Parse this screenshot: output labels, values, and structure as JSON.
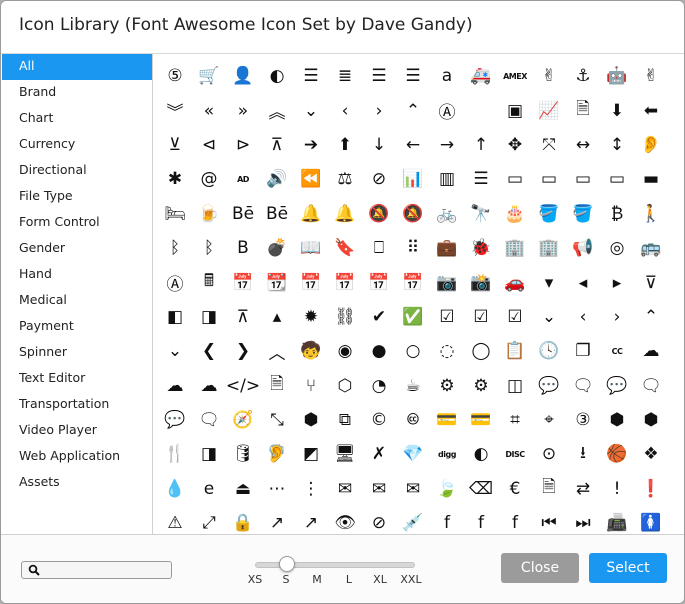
{
  "dialog": {
    "title": "Icon Library (Font Awesome Icon Set by Dave Gandy)"
  },
  "categories": [
    {
      "label": "All",
      "selected": true
    },
    {
      "label": "Brand"
    },
    {
      "label": "Chart"
    },
    {
      "label": "Currency"
    },
    {
      "label": "Directional"
    },
    {
      "label": "File Type"
    },
    {
      "label": "Form Control"
    },
    {
      "label": "Gender"
    },
    {
      "label": "Hand"
    },
    {
      "label": "Medical"
    },
    {
      "label": "Payment"
    },
    {
      "label": "Spinner"
    },
    {
      "label": "Text Editor"
    },
    {
      "label": "Transportation"
    },
    {
      "label": "Video Player"
    },
    {
      "label": "Web Application"
    },
    {
      "label": "Assets"
    }
  ],
  "icons": [
    {
      "name": "html5-icon",
      "glyph": "⑤"
    },
    {
      "name": "cart-plus-icon",
      "glyph": "🛒"
    },
    {
      "name": "user-plus-icon",
      "glyph": "👤"
    },
    {
      "name": "adjust-icon",
      "glyph": "◐"
    },
    {
      "name": "align-center-icon",
      "glyph": "☰"
    },
    {
      "name": "align-justify-icon",
      "glyph": "≣"
    },
    {
      "name": "align-left-icon",
      "glyph": "☰"
    },
    {
      "name": "align-right-icon",
      "glyph": "☰"
    },
    {
      "name": "amazon-icon",
      "glyph": "a"
    },
    {
      "name": "ambulance-icon",
      "glyph": "🚑"
    },
    {
      "name": "american-express-icon",
      "glyph": "AMEX",
      "small": true
    },
    {
      "name": "angellist-icon",
      "glyph": "✌"
    },
    {
      "name": "anchor-icon",
      "glyph": "⚓"
    },
    {
      "name": "android-icon",
      "glyph": "🤖"
    },
    {
      "name": "peace-hand-icon",
      "glyph": "✌"
    },
    {
      "name": "angle-double-down-icon",
      "glyph": "︾"
    },
    {
      "name": "angle-double-left-icon",
      "glyph": "«"
    },
    {
      "name": "angle-double-right-icon",
      "glyph": "»"
    },
    {
      "name": "angle-double-up-icon",
      "glyph": "︽"
    },
    {
      "name": "angle-down-icon",
      "glyph": "⌄"
    },
    {
      "name": "angle-left-icon",
      "glyph": "‹"
    },
    {
      "name": "angle-right-icon",
      "glyph": "›"
    },
    {
      "name": "angle-up-icon",
      "glyph": "⌃"
    },
    {
      "name": "app-store-icon",
      "glyph": "Ⓐ"
    },
    {
      "name": "apple-icon",
      "glyph": ""
    },
    {
      "name": "archive-icon",
      "glyph": "▣"
    },
    {
      "name": "area-chart-icon",
      "glyph": "📈"
    },
    {
      "name": "file-audio-icon",
      "glyph": "🗎"
    },
    {
      "name": "arrow-circle-down-icon",
      "glyph": "⬇"
    },
    {
      "name": "arrow-circle-left-icon",
      "glyph": "⬅"
    },
    {
      "name": "arrow-circle-o-down-icon",
      "glyph": "⊻"
    },
    {
      "name": "arrow-circle-o-left-icon",
      "glyph": "⊲"
    },
    {
      "name": "arrow-circle-o-right-icon",
      "glyph": "⊳"
    },
    {
      "name": "arrow-circle-o-up-icon",
      "glyph": "⊼"
    },
    {
      "name": "arrow-circle-right-icon",
      "glyph": "➔"
    },
    {
      "name": "arrow-circle-up-icon",
      "glyph": "⬆"
    },
    {
      "name": "arrow-down-icon",
      "glyph": "↓"
    },
    {
      "name": "arrow-left-icon",
      "glyph": "←"
    },
    {
      "name": "arrow-right-icon",
      "glyph": "→"
    },
    {
      "name": "arrow-up-icon",
      "glyph": "↑"
    },
    {
      "name": "arrows-icon",
      "glyph": "✥"
    },
    {
      "name": "arrows-alt-icon",
      "glyph": "⤧"
    },
    {
      "name": "arrows-h-icon",
      "glyph": "↔"
    },
    {
      "name": "arrows-v-icon",
      "glyph": "↕"
    },
    {
      "name": "assistive-listening-icon",
      "glyph": "👂"
    },
    {
      "name": "asterisk-icon",
      "glyph": "✱"
    },
    {
      "name": "at-icon",
      "glyph": "@"
    },
    {
      "name": "audio-description-icon",
      "glyph": "AD",
      "small": true
    },
    {
      "name": "file-audio-o-icon",
      "glyph": "🔊"
    },
    {
      "name": "backward-icon",
      "glyph": "⏪"
    },
    {
      "name": "balance-scale-icon",
      "glyph": "⚖"
    },
    {
      "name": "ban-icon",
      "glyph": "⊘"
    },
    {
      "name": "bar-chart-icon",
      "glyph": "📊"
    },
    {
      "name": "barcode-icon",
      "glyph": "▥"
    },
    {
      "name": "bars-icon",
      "glyph": "☰"
    },
    {
      "name": "battery-empty-icon",
      "glyph": "▭"
    },
    {
      "name": "battery-quarter-icon",
      "glyph": "▭"
    },
    {
      "name": "battery-half-icon",
      "glyph": "▭"
    },
    {
      "name": "battery-three-quarters-icon",
      "glyph": "▭"
    },
    {
      "name": "battery-full-icon",
      "glyph": "▬"
    },
    {
      "name": "bed-icon",
      "glyph": "🛏"
    },
    {
      "name": "beer-icon",
      "glyph": "🍺"
    },
    {
      "name": "behance-icon",
      "glyph": "Bē"
    },
    {
      "name": "behance-square-icon",
      "glyph": "Bē"
    },
    {
      "name": "bell-icon",
      "glyph": "🔔"
    },
    {
      "name": "bell-o-icon",
      "glyph": "🔔"
    },
    {
      "name": "bell-slash-icon",
      "glyph": "🔕"
    },
    {
      "name": "bell-slash-o-icon",
      "glyph": "🔕"
    },
    {
      "name": "bicycle-icon",
      "glyph": "🚲"
    },
    {
      "name": "binoculars-icon",
      "glyph": "🔭"
    },
    {
      "name": "birthday-cake-icon",
      "glyph": "🎂"
    },
    {
      "name": "bitbucket-icon",
      "glyph": "🪣"
    },
    {
      "name": "bitbucket-square-icon",
      "glyph": "🪣"
    },
    {
      "name": "bitcoin-icon",
      "glyph": "₿"
    },
    {
      "name": "blind-icon",
      "glyph": "🚶"
    },
    {
      "name": "bluetooth-icon",
      "glyph": "ᛒ"
    },
    {
      "name": "bluetooth-b-icon",
      "glyph": "ᛒ"
    },
    {
      "name": "bold-icon",
      "glyph": "B"
    },
    {
      "name": "bomb-icon",
      "glyph": "💣"
    },
    {
      "name": "book-icon",
      "glyph": "📖"
    },
    {
      "name": "bookmark-icon",
      "glyph": "🔖"
    },
    {
      "name": "bookmark-o-icon",
      "glyph": "⎕"
    },
    {
      "name": "braille-icon",
      "glyph": "⠿"
    },
    {
      "name": "briefcase-icon",
      "glyph": "💼"
    },
    {
      "name": "bug-icon",
      "glyph": "🐞"
    },
    {
      "name": "building-icon",
      "glyph": "🏢"
    },
    {
      "name": "building-o-icon",
      "glyph": "🏢"
    },
    {
      "name": "bullhorn-icon",
      "glyph": "📢"
    },
    {
      "name": "bullseye-icon",
      "glyph": "◎"
    },
    {
      "name": "bus-icon",
      "glyph": "🚌"
    },
    {
      "name": "buysellads-icon",
      "glyph": "Ⓐ"
    },
    {
      "name": "calculator-icon",
      "glyph": "🖩"
    },
    {
      "name": "calendar-icon",
      "glyph": "📅"
    },
    {
      "name": "calendar-o-icon",
      "glyph": "📆"
    },
    {
      "name": "calendar-minus-icon",
      "glyph": "📅"
    },
    {
      "name": "calendar-plus-icon",
      "glyph": "📅"
    },
    {
      "name": "calendar-times-icon",
      "glyph": "📅"
    },
    {
      "name": "calendar-check-icon",
      "glyph": "📅"
    },
    {
      "name": "camera-icon",
      "glyph": "📷"
    },
    {
      "name": "camera-retro-icon",
      "glyph": "📸"
    },
    {
      "name": "car-icon",
      "glyph": "🚗"
    },
    {
      "name": "caret-down-icon",
      "glyph": "▾"
    },
    {
      "name": "caret-left-icon",
      "glyph": "◂"
    },
    {
      "name": "caret-right-icon",
      "glyph": "▸"
    },
    {
      "name": "caret-square-down-icon",
      "glyph": "⊽"
    },
    {
      "name": "caret-square-left-icon",
      "glyph": "◧"
    },
    {
      "name": "caret-square-right-icon",
      "glyph": "◨"
    },
    {
      "name": "caret-square-up-icon",
      "glyph": "⊼"
    },
    {
      "name": "caret-up-icon",
      "glyph": "▴"
    },
    {
      "name": "certificate-icon",
      "glyph": "✹"
    },
    {
      "name": "chain-broken-icon",
      "glyph": "⛓"
    },
    {
      "name": "check-icon",
      "glyph": "✔"
    },
    {
      "name": "check-circle-icon",
      "glyph": "✅"
    },
    {
      "name": "check-circle-o-icon",
      "glyph": "☑"
    },
    {
      "name": "check-square-icon",
      "glyph": "☑"
    },
    {
      "name": "check-square-o-icon",
      "glyph": "☑"
    },
    {
      "name": "chevron-circle-down-icon",
      "glyph": "⌄"
    },
    {
      "name": "chevron-circle-left-icon",
      "glyph": "‹"
    },
    {
      "name": "chevron-circle-right-icon",
      "glyph": "›"
    },
    {
      "name": "chevron-circle-up-icon",
      "glyph": "⌃"
    },
    {
      "name": "chevron-down-icon",
      "glyph": "⌄"
    },
    {
      "name": "chevron-left-icon",
      "glyph": "❮"
    },
    {
      "name": "chevron-right-icon",
      "glyph": "❯"
    },
    {
      "name": "chevron-up-icon",
      "glyph": "︿"
    },
    {
      "name": "child-icon",
      "glyph": "🧒"
    },
    {
      "name": "chrome-icon",
      "glyph": "◉"
    },
    {
      "name": "circle-icon",
      "glyph": "●"
    },
    {
      "name": "circle-o-icon",
      "glyph": "○"
    },
    {
      "name": "circle-o-notch-icon",
      "glyph": "◌"
    },
    {
      "name": "circle-thin-icon",
      "glyph": "◯"
    },
    {
      "name": "clipboard-icon",
      "glyph": "📋"
    },
    {
      "name": "clock-icon",
      "glyph": "🕓"
    },
    {
      "name": "clone-icon",
      "glyph": "❐"
    },
    {
      "name": "closed-captioning-icon",
      "glyph": "CC",
      "small": true
    },
    {
      "name": "cloud-icon",
      "glyph": "☁"
    },
    {
      "name": "cloud-download-icon",
      "glyph": "☁"
    },
    {
      "name": "cloud-upload-icon",
      "glyph": "☁"
    },
    {
      "name": "code-icon",
      "glyph": "</>"
    },
    {
      "name": "file-code-icon",
      "glyph": "🗎"
    },
    {
      "name": "code-fork-icon",
      "glyph": "⑂"
    },
    {
      "name": "codepen-icon",
      "glyph": "⬡"
    },
    {
      "name": "codiepie-icon",
      "glyph": "◔"
    },
    {
      "name": "coffee-icon",
      "glyph": "☕"
    },
    {
      "name": "cog-icon",
      "glyph": "⚙"
    },
    {
      "name": "cogs-icon",
      "glyph": "⚙"
    },
    {
      "name": "columns-icon",
      "glyph": "◫"
    },
    {
      "name": "comment-icon",
      "glyph": "💬"
    },
    {
      "name": "comment-o-icon",
      "glyph": "🗨"
    },
    {
      "name": "commenting-icon",
      "glyph": "💬"
    },
    {
      "name": "commenting-o-icon",
      "glyph": "🗨"
    },
    {
      "name": "comments-icon",
      "glyph": "💬"
    },
    {
      "name": "comments-o-icon",
      "glyph": "🗨"
    },
    {
      "name": "compass-icon",
      "glyph": "🧭"
    },
    {
      "name": "compress-icon",
      "glyph": "⤡"
    },
    {
      "name": "connectdevelop-icon",
      "glyph": "⬢"
    },
    {
      "name": "contao-icon",
      "glyph": "⧉"
    },
    {
      "name": "copyright-icon",
      "glyph": "©"
    },
    {
      "name": "creative-commons-icon",
      "glyph": "🅭"
    },
    {
      "name": "credit-card-icon",
      "glyph": "💳"
    },
    {
      "name": "credit-card-alt-icon",
      "glyph": "💳"
    },
    {
      "name": "crop-icon",
      "glyph": "⌗"
    },
    {
      "name": "crosshairs-icon",
      "glyph": "⌖"
    },
    {
      "name": "css3-icon",
      "glyph": "③"
    },
    {
      "name": "cube-icon",
      "glyph": "⬢"
    },
    {
      "name": "cubes-icon",
      "glyph": "⬢"
    },
    {
      "name": "cutlery-icon",
      "glyph": "🍴"
    },
    {
      "name": "dashcube-icon",
      "glyph": "◨"
    },
    {
      "name": "database-icon",
      "glyph": "🛢"
    },
    {
      "name": "deaf-icon",
      "glyph": "🦻"
    },
    {
      "name": "delicious-icon",
      "glyph": "◩"
    },
    {
      "name": "desktop-icon",
      "glyph": "🖥"
    },
    {
      "name": "deviantart-icon",
      "glyph": "✗"
    },
    {
      "name": "diamond-icon",
      "glyph": "💎"
    },
    {
      "name": "digg-icon",
      "glyph": "digg",
      "small": true
    },
    {
      "name": "diners-club-icon",
      "glyph": "◐"
    },
    {
      "name": "discover-icon",
      "glyph": "DISC",
      "small": true
    },
    {
      "name": "dot-circle-icon",
      "glyph": "⊙"
    },
    {
      "name": "download-icon",
      "glyph": "⭳"
    },
    {
      "name": "dribbble-icon",
      "glyph": "🏀"
    },
    {
      "name": "dropbox-icon",
      "glyph": "❖"
    },
    {
      "name": "drupal-icon",
      "glyph": "💧"
    },
    {
      "name": "edge-icon",
      "glyph": "e"
    },
    {
      "name": "eject-icon",
      "glyph": "⏏"
    },
    {
      "name": "ellipsis-h-icon",
      "glyph": "⋯"
    },
    {
      "name": "ellipsis-v-icon",
      "glyph": "⋮"
    },
    {
      "name": "envelope-icon",
      "glyph": "✉"
    },
    {
      "name": "envelope-o-icon",
      "glyph": "✉"
    },
    {
      "name": "envelope-square-icon",
      "glyph": "✉"
    },
    {
      "name": "envira-icon",
      "glyph": "🍃"
    },
    {
      "name": "eraser-icon",
      "glyph": "⌫"
    },
    {
      "name": "euro-icon",
      "glyph": "€"
    },
    {
      "name": "file-excel-icon",
      "glyph": "🗎"
    },
    {
      "name": "exchange-icon",
      "glyph": "⇄"
    },
    {
      "name": "exclamation-icon",
      "glyph": "!"
    },
    {
      "name": "exclamation-circle-icon",
      "glyph": "❗"
    },
    {
      "name": "exclamation-triangle-icon",
      "glyph": "⚠"
    },
    {
      "name": "expand-icon",
      "glyph": "⤢"
    },
    {
      "name": "expeditedssl-icon",
      "glyph": "🔒"
    },
    {
      "name": "external-link-icon",
      "glyph": "↗"
    },
    {
      "name": "external-link-square-icon",
      "glyph": "↗"
    },
    {
      "name": "eye-icon",
      "glyph": "👁"
    },
    {
      "name": "eye-slash-icon",
      "glyph": "⊘"
    },
    {
      "name": "eyedropper-icon",
      "glyph": "💉"
    },
    {
      "name": "facebook-icon",
      "glyph": "f"
    },
    {
      "name": "facebook-official-icon",
      "glyph": "f"
    },
    {
      "name": "facebook-square-icon",
      "glyph": "f"
    },
    {
      "name": "fast-backward-icon",
      "glyph": "⏮"
    },
    {
      "name": "fast-forward-icon",
      "glyph": "⏭"
    },
    {
      "name": "fax-icon",
      "glyph": "📠"
    },
    {
      "name": "female-icon",
      "glyph": "🚺"
    }
  ],
  "search": {
    "value": "",
    "placeholder": ""
  },
  "slider": {
    "labels": [
      "XS",
      "S",
      "M",
      "L",
      "XL",
      "XXL"
    ],
    "selected": "S"
  },
  "buttons": {
    "close": "Close",
    "select": "Select"
  }
}
